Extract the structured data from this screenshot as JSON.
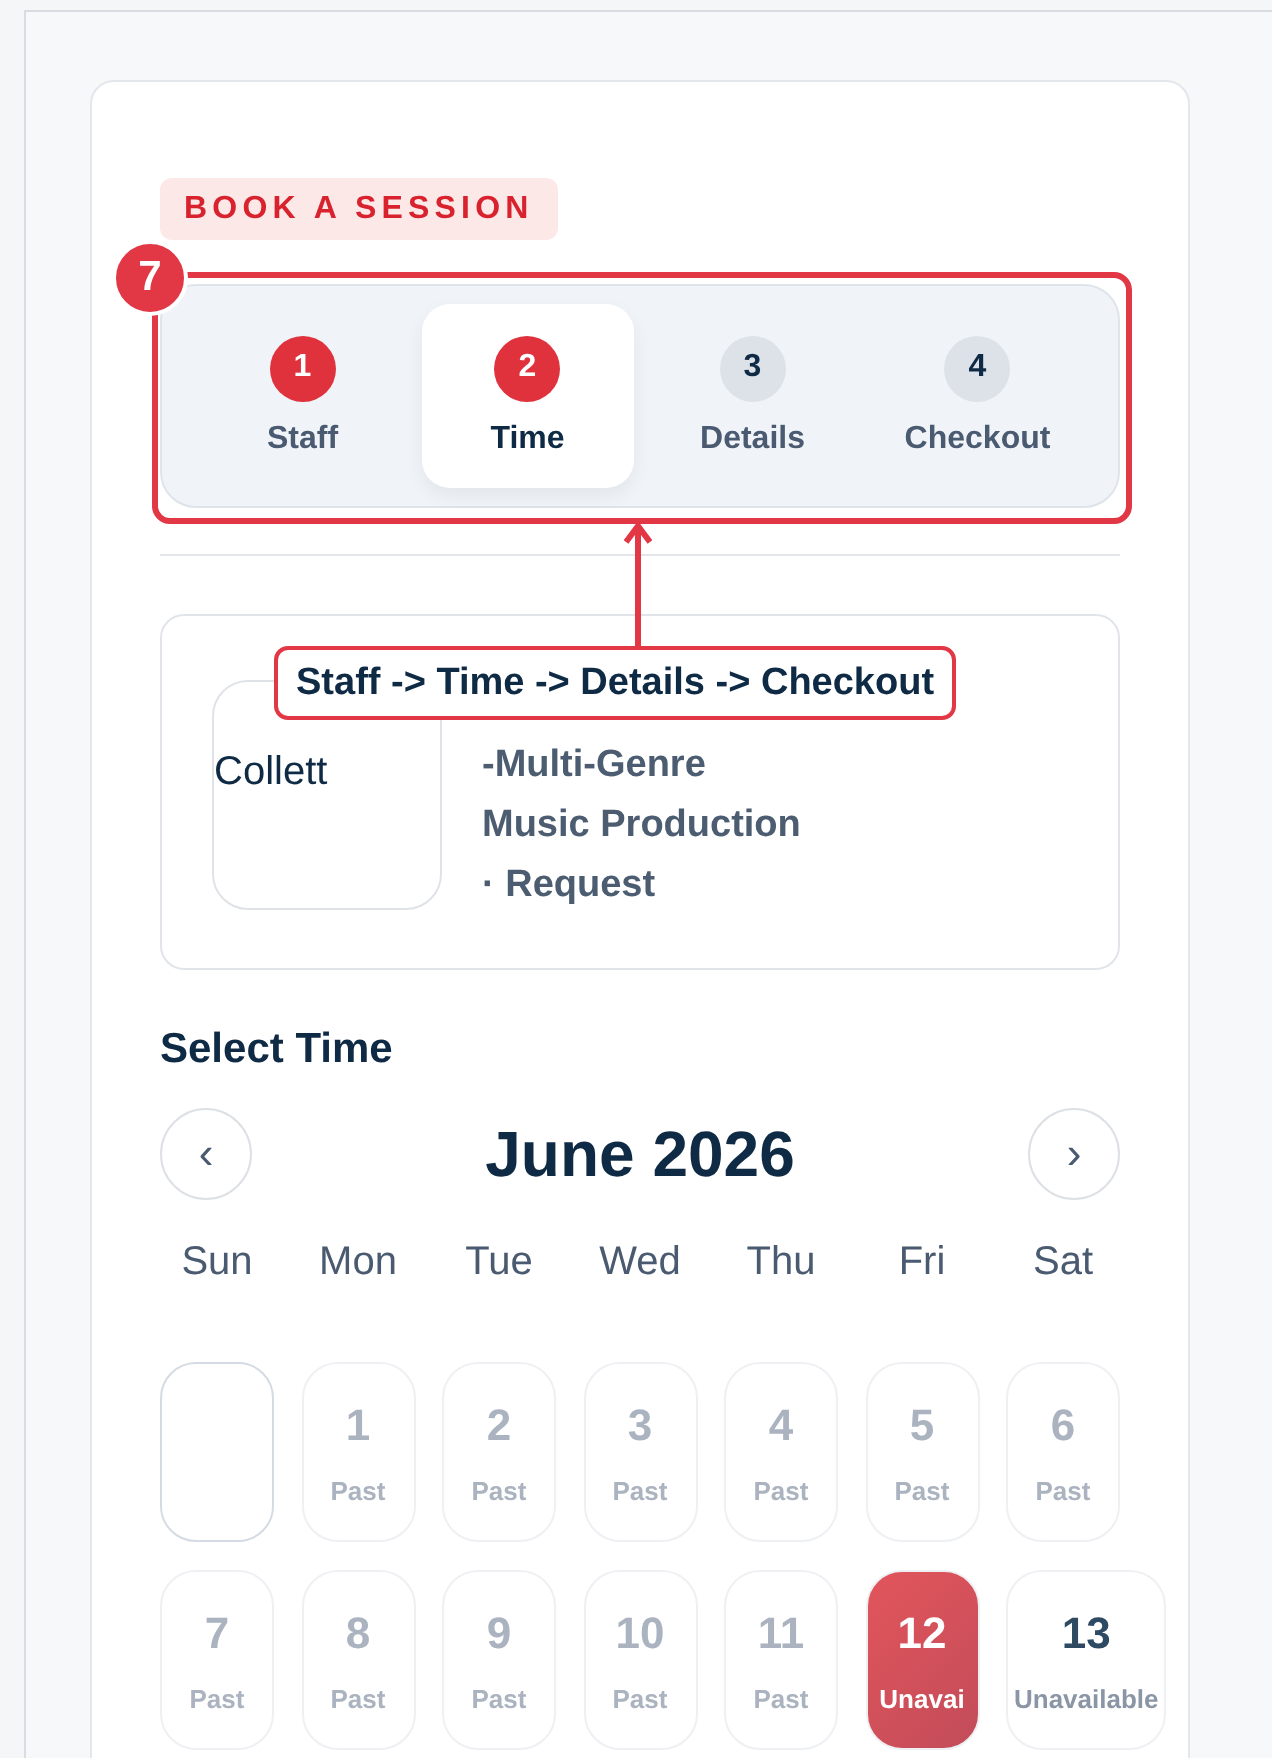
{
  "badge": "BOOK A SESSION",
  "steps": [
    {
      "number": "1",
      "label": "Staff",
      "reached": true,
      "selected": false
    },
    {
      "number": "2",
      "label": "Time",
      "reached": true,
      "selected": true
    },
    {
      "number": "3",
      "label": "Details",
      "reached": false,
      "selected": false
    },
    {
      "number": "4",
      "label": "Checkout",
      "reached": false,
      "selected": false
    }
  ],
  "annotation": {
    "number": "7",
    "label": "Staff -> Time -> Details -> Checkout"
  },
  "staff": {
    "image_alt": "Collett",
    "lines": [
      "-Multi-Genre",
      "Music Production",
      "· Request"
    ]
  },
  "section_title": "Select Time",
  "calendar": {
    "prev": "‹",
    "month": "June 2026",
    "next": "›",
    "weekdays": [
      "Sun",
      "Mon",
      "Tue",
      "Wed",
      "Thu",
      "Fri",
      "Sat"
    ],
    "days": [
      {
        "kind": "blank"
      },
      {
        "kind": "past",
        "day": "1",
        "note": "Past",
        "selected": false
      },
      {
        "kind": "past",
        "day": "2",
        "note": "Past",
        "selected": false
      },
      {
        "kind": "past",
        "day": "3",
        "note": "Past",
        "selected": false
      },
      {
        "kind": "past",
        "day": "4",
        "note": "Past",
        "selected": false
      },
      {
        "kind": "past",
        "day": "5",
        "note": "Past",
        "selected": false
      },
      {
        "kind": "past",
        "day": "6",
        "note": "Past",
        "selected": false
      },
      {
        "kind": "past",
        "day": "7",
        "note": "Past",
        "selected": false
      },
      {
        "kind": "past",
        "day": "8",
        "note": "Past",
        "selected": false
      },
      {
        "kind": "past",
        "day": "9",
        "note": "Past",
        "selected": false
      },
      {
        "kind": "past",
        "day": "10",
        "note": "Past",
        "selected": false
      },
      {
        "kind": "past",
        "day": "11",
        "note": "Past",
        "selected": false
      },
      {
        "kind": "unavailable",
        "day": "12",
        "note": "Unavai",
        "selected": true
      },
      {
        "kind": "unavailable",
        "day": "13",
        "note": "Unavailable",
        "selected": false
      }
    ]
  }
}
